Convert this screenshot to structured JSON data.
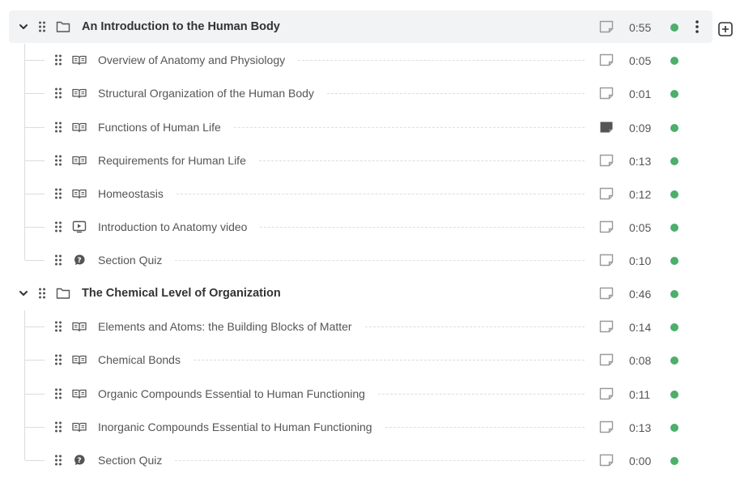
{
  "colors": {
    "status_published": "#4caf6a",
    "note_empty": "#9a9a9a",
    "note_filled": "#555555"
  },
  "sections": [
    {
      "title": "An Introduction to the Human Body",
      "duration": "0:55",
      "active": true,
      "lessons": [
        {
          "title": "Overview of Anatomy and Physiology",
          "duration": "0:05",
          "type": "book-icon",
          "note": "empty"
        },
        {
          "title": "Structural Organization of the Human Body",
          "duration": "0:01",
          "type": "book-icon",
          "note": "empty"
        },
        {
          "title": "Functions of Human Life",
          "duration": "0:09",
          "type": "book-icon",
          "note": "filled"
        },
        {
          "title": "Requirements for Human Life",
          "duration": "0:13",
          "type": "book-icon",
          "note": "empty"
        },
        {
          "title": "Homeostasis",
          "duration": "0:12",
          "type": "book-icon",
          "note": "empty"
        },
        {
          "title": "Introduction to Anatomy video",
          "duration": "0:05",
          "type": "video-icon",
          "note": "empty"
        },
        {
          "title": "Section Quiz",
          "duration": "0:10",
          "type": "quiz-icon",
          "note": "empty"
        }
      ]
    },
    {
      "title": "The Chemical Level of Organization",
      "duration": "0:46",
      "active": false,
      "lessons": [
        {
          "title": "Elements and Atoms: the Building Blocks of Matter",
          "duration": "0:14",
          "type": "book-icon",
          "note": "empty"
        },
        {
          "title": "Chemical Bonds",
          "duration": "0:08",
          "type": "book-icon",
          "note": "empty"
        },
        {
          "title": "Organic Compounds Essential to Human Functioning",
          "duration": "0:11",
          "type": "book-icon",
          "note": "empty"
        },
        {
          "title": "Inorganic Compounds Essential to Human Functioning",
          "duration": "0:13",
          "type": "book-icon",
          "note": "empty"
        },
        {
          "title": "Section Quiz",
          "duration": "0:00",
          "type": "quiz-icon",
          "note": "empty"
        }
      ]
    }
  ]
}
